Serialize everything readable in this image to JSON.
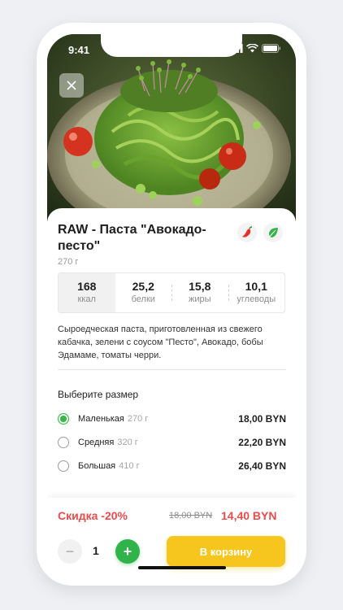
{
  "status": {
    "time": "9:41"
  },
  "product": {
    "title": "RAW - Паста \"Авокадо-песто\"",
    "weight": "270 г",
    "description": "Сыроедческая паста, приготовленная из свежего кабачка, зелени с соусом \"Песто\", Авокадо, бобы Эдамаме, томаты черри."
  },
  "nutrition": [
    {
      "value": "168",
      "label": "ккал"
    },
    {
      "value": "25,2",
      "label": "белки"
    },
    {
      "value": "15,8",
      "label": "жиры"
    },
    {
      "value": "10,1",
      "label": "углеводы"
    }
  ],
  "sizes": {
    "title": "Выберите размер",
    "options": [
      {
        "name": "Маленькая",
        "weight": "270 г",
        "price": "18,00 BYN",
        "selected": true
      },
      {
        "name": "Средняя",
        "weight": "320 г",
        "price": "22,20 BYN",
        "selected": false
      },
      {
        "name": "Большая",
        "weight": "410 г",
        "price": "26,40 BYN",
        "selected": false
      }
    ]
  },
  "cart": {
    "discount": "Скидка -20%",
    "old_price": "18,00 BYN",
    "new_price": "14,40 BYN",
    "quantity": "1",
    "minus": "−",
    "plus": "+",
    "button": "В корзину"
  },
  "icons": [
    "close-icon",
    "chili-pepper-icon",
    "leaf-icon",
    "signal-icon",
    "wifi-icon",
    "battery-icon",
    "minus-icon",
    "plus-icon"
  ],
  "colors": {
    "accent_green": "#2fb34a",
    "discount_red": "#ea4b4b",
    "cart_yellow": "#f7c61e"
  }
}
